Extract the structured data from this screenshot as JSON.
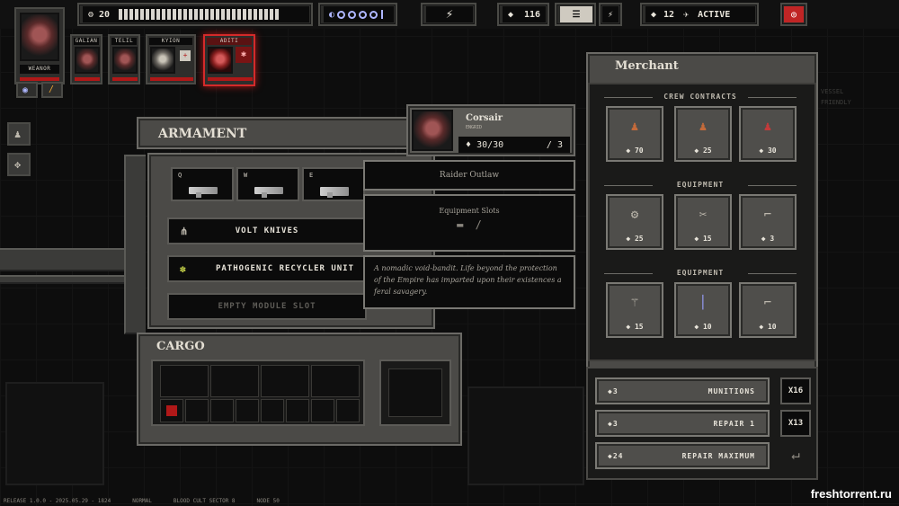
{
  "topbar": {
    "crew_count": "20",
    "fuel_ticks": 30,
    "scrap": "116",
    "threat": "12",
    "status": "ACTIVE"
  },
  "captain": {
    "name": "WEANOR"
  },
  "crew": [
    {
      "name": "GALIAN"
    },
    {
      "name": "TELIL"
    },
    {
      "name": "KYION"
    },
    {
      "name": "ADITI"
    }
  ],
  "armament": {
    "title": "ARMAMENT",
    "weapon_keys": [
      "Q",
      "W",
      "E"
    ],
    "modules": [
      "VOLT KNIVES",
      "PATHOGENIC RECYCLER UNIT",
      "EMPTY MODULE SLOT"
    ]
  },
  "cargo": {
    "title": "CARGO"
  },
  "unit_card": {
    "name": "Corsair",
    "subtitle": "ENGRID",
    "health": "30/30",
    "attack": "3",
    "class": "Raider Outlaw",
    "equipment_label": "Equipment Slots",
    "description": "A nomadic void-bandit. Life beyond the protection of the Empire has imparted upon their existences a feral savagery."
  },
  "merchant": {
    "title": "Merchant",
    "sections": [
      {
        "heading": "CREW CONTRACTS",
        "items": [
          {
            "price": "70"
          },
          {
            "price": "25"
          },
          {
            "price": "30"
          }
        ]
      },
      {
        "heading": "EQUIPMENT",
        "items": [
          {
            "price": "25"
          },
          {
            "price": "15"
          },
          {
            "price": "3"
          }
        ]
      },
      {
        "heading": "EQUIPMENT",
        "items": [
          {
            "price": "15"
          },
          {
            "price": "10"
          },
          {
            "price": "10"
          }
        ]
      }
    ],
    "buy": [
      {
        "cost": "3",
        "label": "MUNITIONS",
        "qty": "X16"
      },
      {
        "cost": "3",
        "label": "REPAIR 1",
        "qty": "X13"
      },
      {
        "cost": "24",
        "label": "REPAIR MAXIMUM"
      }
    ]
  },
  "bg_text": {
    "line1": "VESSEL",
    "line2": "FRIENDLY"
  },
  "footer": {
    "release": "RELEASE 1.0.0 - 2025.05.29 - 1824",
    "difficulty": "NORMAL",
    "sector": "BLOOD CULT SECTOR 8",
    "node": "NODE 50"
  },
  "watermark": "freshtorrent.ru"
}
